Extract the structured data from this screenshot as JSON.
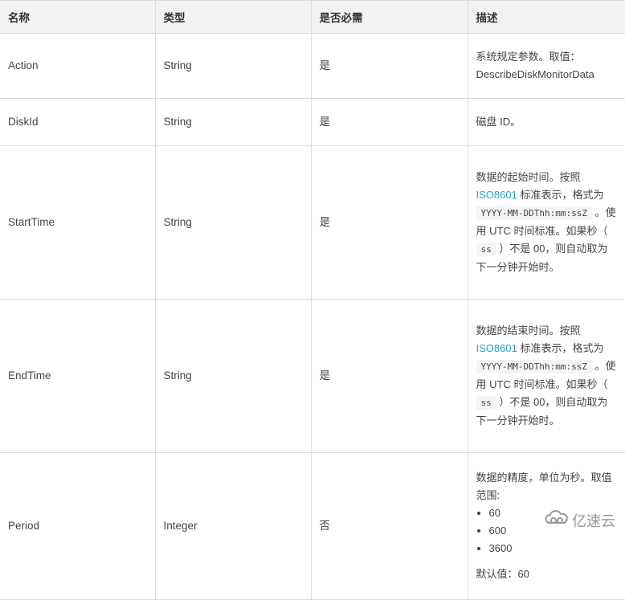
{
  "table": {
    "headers": [
      "名称",
      "类型",
      "是否必需",
      "描述"
    ],
    "rows": [
      {
        "name": "Action",
        "type": "String",
        "required": "是",
        "desc_line1": "系统规定参数。取值：",
        "desc_line2": "DescribeDiskMonitorData"
      },
      {
        "name": "DiskId",
        "type": "String",
        "required": "是",
        "desc": "磁盘 ID。"
      },
      {
        "name": "StartTime",
        "type": "String",
        "required": "是",
        "desc_a": "数据的起始时间。按照 ",
        "desc_link": "ISO8601",
        "desc_b": " 标准表示，格式为 ",
        "desc_code1": "YYYY-MM-DDThh:mm:ssZ",
        "desc_c": " 。使用 UTC 时间标准。如果秒（ ",
        "desc_code2": "ss",
        "desc_d": " ）不是 00，则自动取为下一分钟开始时。"
      },
      {
        "name": "EndTime",
        "type": "String",
        "required": "是",
        "desc_a": "数据的结束时间。按照 ",
        "desc_link": "ISO8601",
        "desc_b": " 标准表示，格式为 ",
        "desc_code1": "YYYY-MM-DDThh:mm:ssZ",
        "desc_c": " 。使用 UTC 时间标准。如果秒（ ",
        "desc_code2": "ss",
        "desc_d": " ）不是 00，则自动取为下一分钟开始时。"
      },
      {
        "name": "Period",
        "type": "Integer",
        "required": "否",
        "desc_intro": "数据的精度，单位为秒。取值范围:",
        "desc_values": [
          "60",
          "600",
          "3600"
        ],
        "desc_default": "默认值：60"
      }
    ]
  },
  "watermark": {
    "text": "亿速云",
    "icon": "cloud-logo-icon"
  },
  "colors": {
    "link": "#2aa1c6",
    "header_bg": "#f2f2f2",
    "border": "#dcdcdc"
  }
}
